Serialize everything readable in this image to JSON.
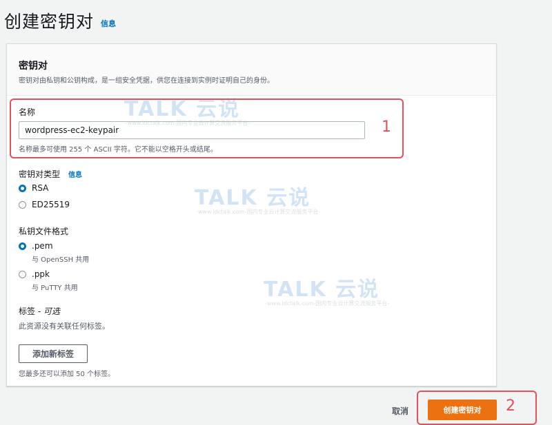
{
  "page": {
    "title": "创建密钥对",
    "info_link": "信息"
  },
  "panel": {
    "title": "密钥对",
    "description": "密钥对由私钥和公钥构成，是一组安全凭据，供您在连接到实例时证明自己的身份。"
  },
  "name_field": {
    "label": "名称",
    "value": "wordpress-ec2-keypair",
    "hint": "名称最多可使用 255 个 ASCII 字符。它不能以空格开头或结尾。"
  },
  "key_type": {
    "label": "密钥对类型",
    "info_link": "信息",
    "options": [
      {
        "label": "RSA",
        "selected": true
      },
      {
        "label": "ED25519",
        "selected": false
      }
    ]
  },
  "file_format": {
    "label": "私钥文件格式",
    "options": [
      {
        "label": ".pem",
        "sub": "与 OpenSSH 共用",
        "selected": true
      },
      {
        "label": ".ppk",
        "sub": "与 PuTTY 共用",
        "selected": false
      }
    ]
  },
  "tags": {
    "label": "标签",
    "optional": "- 可选",
    "empty_text": "此资源没有关联任何标签。",
    "add_button": "添加新标签",
    "limit_hint": "您最多还可以添加 50 个标签。"
  },
  "footer": {
    "cancel": "取消",
    "create": "创建密钥对"
  },
  "annotations": {
    "n1": "1",
    "n2": "2",
    "color": "#e3505a"
  },
  "watermark": {
    "main": "TALK 云说",
    "sub": "-www.idctalk.com-国内专业云计算交流服务平台-"
  },
  "colors": {
    "accent": "#0073bb",
    "primary_button": "#ec7211"
  }
}
